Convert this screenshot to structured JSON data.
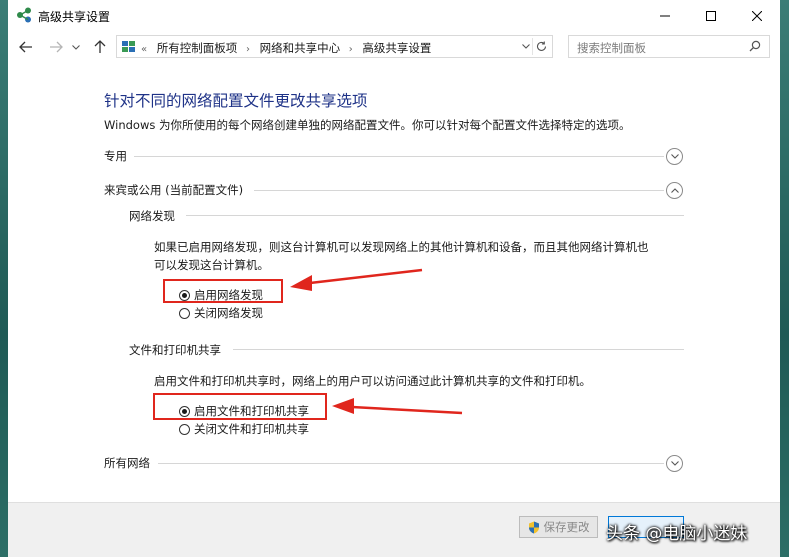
{
  "window": {
    "title": "高级共享设置",
    "controls": {
      "minimize": "minimize-icon",
      "maximize": "maximize-icon",
      "close": "close-icon"
    }
  },
  "nav": {
    "breadcrumbs": [
      "所有控制面板项",
      "网络和共享中心",
      "高级共享设置"
    ],
    "overflow": "«",
    "search_placeholder": "搜索控制面板"
  },
  "page": {
    "heading": "针对不同的网络配置文件更改共享选项",
    "description": "Windows 为你所使用的每个网络创建单独的网络配置文件。你可以针对每个配置文件选择特定的选项。",
    "sections": {
      "private": {
        "label": "专用",
        "state": "collapsed"
      },
      "guest": {
        "label": "来宾或公用 (当前配置文件)",
        "state": "expanded"
      },
      "all": {
        "label": "所有网络",
        "state": "collapsed"
      }
    },
    "network_discovery": {
      "title": "网络发现",
      "line1": "如果已启用网络发现，则这台计算机可以发现网络上的其他计算机和设备，而且其他网络计算机也",
      "line2": "可以发现这台计算机。",
      "on_label": "启用网络发现",
      "off_label": "关闭网络发现",
      "selected": "on"
    },
    "file_printer": {
      "title": "文件和打印机共享",
      "text": "启用文件和打印机共享时，网络上的用户可以访问通过此计算机共享的文件和打印机。",
      "on_label": "启用文件和打印机共享",
      "off_label": "关闭文件和打印机共享",
      "selected": "on"
    }
  },
  "footer": {
    "save_label": "保存更改",
    "watermark": "头条 @电脑小迷妹"
  },
  "colors": {
    "heading": "#1e3287",
    "highlight": "#e0261d",
    "accent": "#0078d7"
  }
}
